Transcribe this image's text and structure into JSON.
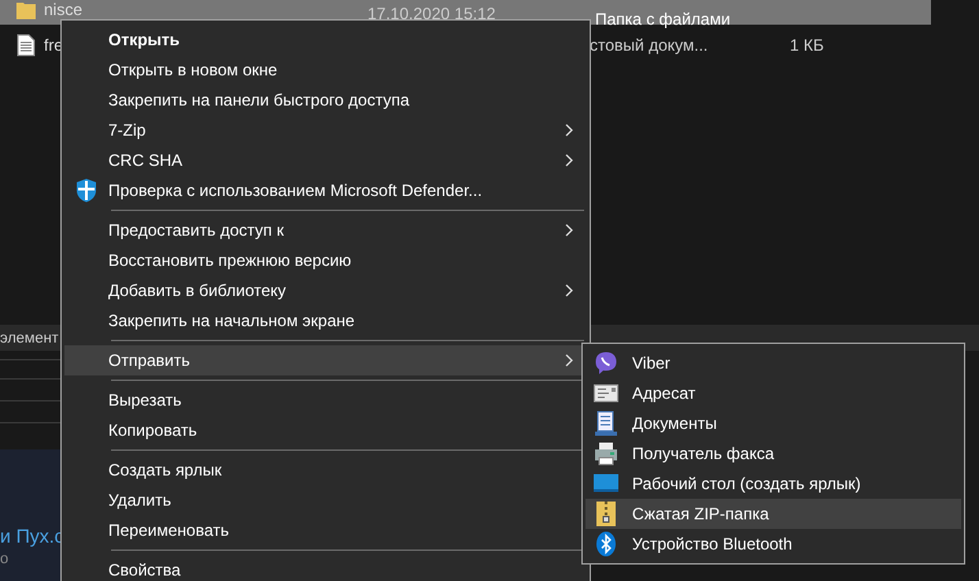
{
  "files": [
    {
      "name": "nisce",
      "date": "17.10.2020 15:12",
      "type": "Папка с файлами",
      "selected": true
    },
    {
      "name": "fre",
      "type": "стовый докум...",
      "size": "1 КБ",
      "selected": false
    }
  ],
  "details_header": "элемент",
  "preview": {
    "title": "и Пух.с",
    "subtitle": "о"
  },
  "context_menu": {
    "items": [
      {
        "kind": "item",
        "label": "Открыть",
        "bold": true,
        "submenu": false,
        "selected": false
      },
      {
        "kind": "item",
        "label": "Открыть в новом окне",
        "bold": false,
        "submenu": false,
        "selected": false
      },
      {
        "kind": "item",
        "label": "Закрепить на панели быстрого доступа",
        "bold": false,
        "submenu": false,
        "selected": false
      },
      {
        "kind": "item",
        "label": "7-Zip",
        "bold": false,
        "submenu": true,
        "selected": false
      },
      {
        "kind": "item",
        "label": "CRC SHA",
        "bold": false,
        "submenu": true,
        "selected": false
      },
      {
        "kind": "icon_item",
        "label": "Проверка с использованием Microsoft Defender...",
        "bold": false,
        "submenu": false,
        "selected": false
      },
      {
        "kind": "separator"
      },
      {
        "kind": "item",
        "label": "Предоставить доступ к",
        "bold": false,
        "submenu": true,
        "selected": false
      },
      {
        "kind": "item",
        "label": "Восстановить прежнюю версию",
        "bold": false,
        "submenu": false,
        "selected": false
      },
      {
        "kind": "item",
        "label": "Добавить в библиотеку",
        "bold": false,
        "submenu": true,
        "selected": false
      },
      {
        "kind": "item",
        "label": "Закрепить на начальном экране",
        "bold": false,
        "submenu": false,
        "selected": false
      },
      {
        "kind": "separator"
      },
      {
        "kind": "item",
        "label": "Отправить",
        "bold": false,
        "submenu": true,
        "selected": true
      },
      {
        "kind": "separator"
      },
      {
        "kind": "item",
        "label": "Вырезать",
        "bold": false,
        "submenu": false,
        "selected": false
      },
      {
        "kind": "item",
        "label": "Копировать",
        "bold": false,
        "submenu": false,
        "selected": false
      },
      {
        "kind": "separator"
      },
      {
        "kind": "item",
        "label": "Создать ярлык",
        "bold": false,
        "submenu": false,
        "selected": false
      },
      {
        "kind": "item",
        "label": "Удалить",
        "bold": false,
        "submenu": false,
        "selected": false
      },
      {
        "kind": "item",
        "label": "Переименовать",
        "bold": false,
        "submenu": false,
        "selected": false
      },
      {
        "kind": "separator"
      },
      {
        "kind": "item",
        "label": "Свойства",
        "bold": false,
        "submenu": false,
        "selected": false
      }
    ]
  },
  "send_to_menu": {
    "items": [
      {
        "label": "Viber",
        "selected": false
      },
      {
        "label": "Адресат",
        "selected": false
      },
      {
        "label": "Документы",
        "selected": false
      },
      {
        "label": "Получатель факса",
        "selected": false
      },
      {
        "label": "Рабочий стол (создать ярлык)",
        "selected": false
      },
      {
        "label": "Сжатая ZIP-папка",
        "selected": true
      },
      {
        "label": "Устройство Bluetooth",
        "selected": false
      }
    ]
  }
}
